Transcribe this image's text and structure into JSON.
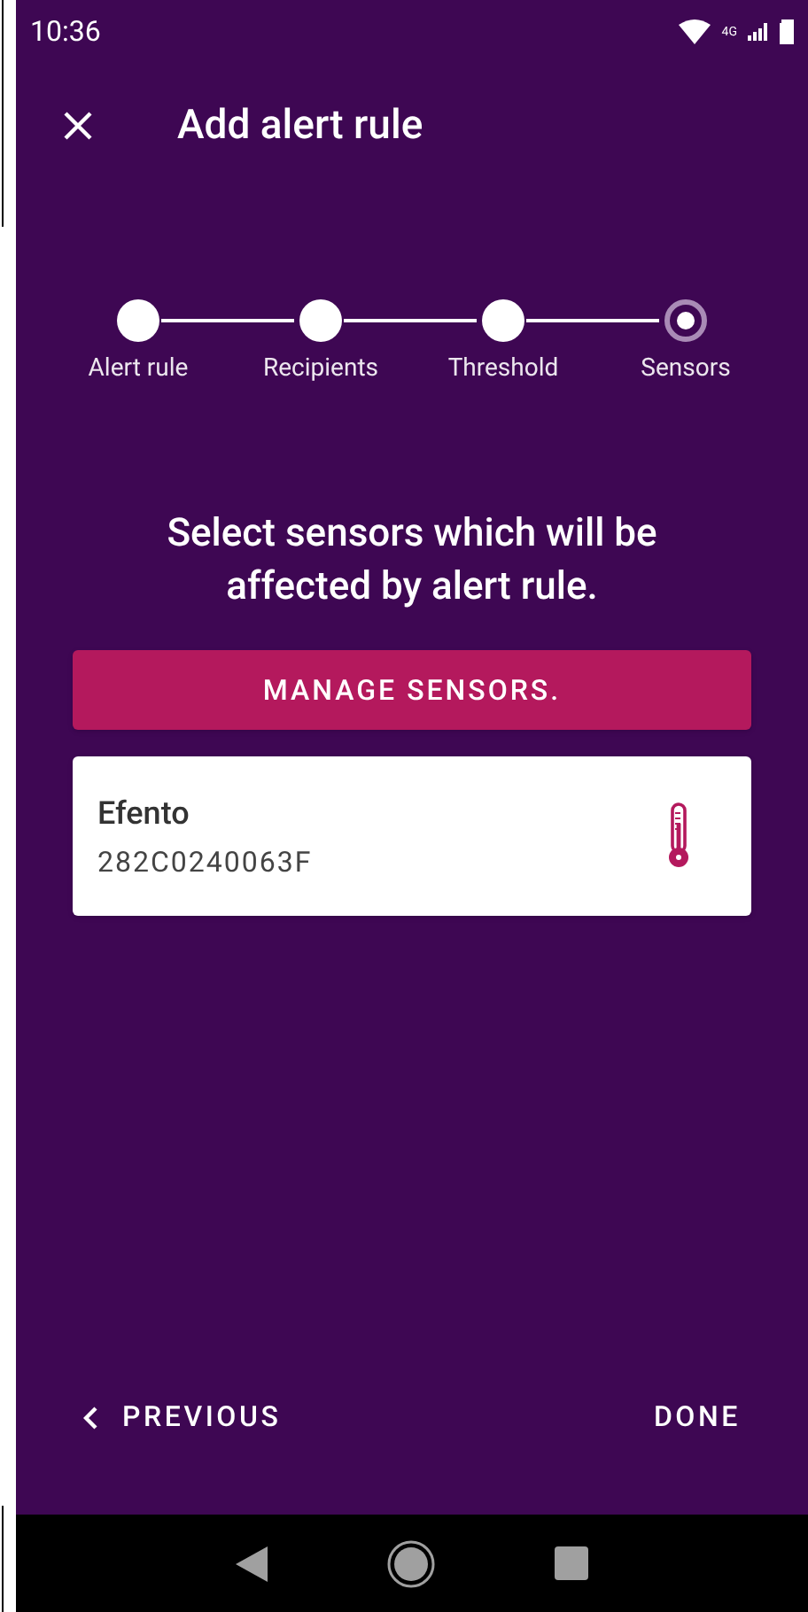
{
  "status_bar": {
    "time": "10:36",
    "network": "4G"
  },
  "app_bar": {
    "title": "Add alert rule"
  },
  "steps": [
    {
      "label": "Alert rule",
      "selected": false
    },
    {
      "label": "Recipients",
      "selected": false
    },
    {
      "label": "Threshold",
      "selected": false
    },
    {
      "label": "Sensors",
      "selected": true
    }
  ],
  "heading": "Select sensors which will be affected by alert rule.",
  "manage_button": "MANAGE SENSORS.",
  "sensors": [
    {
      "name": "Efento",
      "serial": "282C0240063F"
    }
  ],
  "footer": {
    "previous": "PREVIOUS",
    "done": "DONE"
  }
}
